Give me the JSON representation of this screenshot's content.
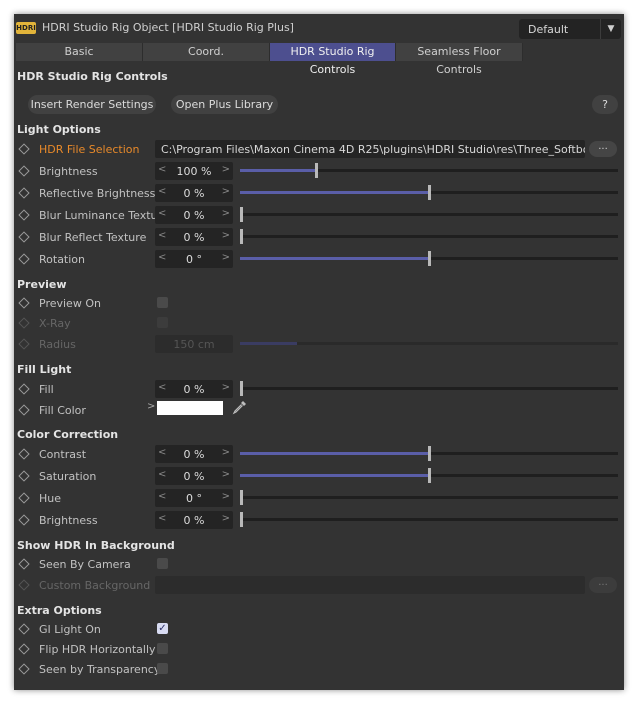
{
  "window": {
    "logo": "HDRI",
    "title": "HDRI Studio Rig Object [HDRI Studio Rig Plus]",
    "preset": "Default"
  },
  "tabs": [
    "Basic",
    "Coord.",
    "HDR Studio Rig Controls",
    "Seamless Floor Controls"
  ],
  "active_tab": "HDR Studio Rig Controls",
  "header": {
    "title": "HDR Studio Rig Controls",
    "insert_button": "Insert Render Settings",
    "library_button": "Open Plus Library",
    "help_button": "?"
  },
  "light_options": {
    "title": "Light Options",
    "hdr_label": "HDR File Selection",
    "hdr_path": "C:\\Program Files\\Maxon Cinema 4D R25\\plugins\\HDRI Studio\\res\\Three_Softboxes_Studio",
    "browse": "...",
    "brightness": {
      "label": "Brightness",
      "value": "100 %",
      "level": 0.2
    },
    "reflective": {
      "label": "Reflective Brightness",
      "value": "0 %",
      "level": 0.5
    },
    "blur_lum": {
      "label": "Blur Luminance Texture",
      "value": "0 %",
      "level": 0
    },
    "blur_ref": {
      "label": "Blur Reflect Texture",
      "value": "0 %",
      "level": 0
    },
    "rotation": {
      "label": "Rotation",
      "value": "0 °",
      "level": 0.5
    }
  },
  "preview": {
    "title": "Preview",
    "preview_on": "Preview On",
    "xray": "X-Ray",
    "radius": {
      "label": "Radius",
      "value": "150 cm",
      "level": 0.15
    }
  },
  "fill_light": {
    "title": "Fill Light",
    "fill": {
      "label": "Fill",
      "value": "0 %",
      "level": 0
    },
    "fill_color": {
      "label": "Fill Color",
      "color": "#ffffff"
    }
  },
  "color_correction": {
    "title": "Color Correction",
    "contrast": {
      "label": "Contrast",
      "value": "0 %",
      "level": 0.5
    },
    "saturation": {
      "label": "Saturation",
      "value": "0 %",
      "level": 0.5
    },
    "hue": {
      "label": "Hue",
      "value": "0 °",
      "level": 0
    },
    "brightness": {
      "label": "Brightness",
      "value": "0 %",
      "level": 0
    }
  },
  "background": {
    "title": "Show HDR In Background",
    "seen_by_camera": "Seen By Camera",
    "custom_bg": "Custom Background",
    "browse": "..."
  },
  "extra": {
    "title": "Extra Options",
    "gi_light": "GI Light On",
    "gi_checked": true,
    "flip": "Flip HDR Horizontally",
    "seen_transparency": "Seen by Transparency"
  },
  "colors": {
    "accent": "#5a5ea8",
    "orange": "#e98a2a",
    "panel": "#333333"
  }
}
